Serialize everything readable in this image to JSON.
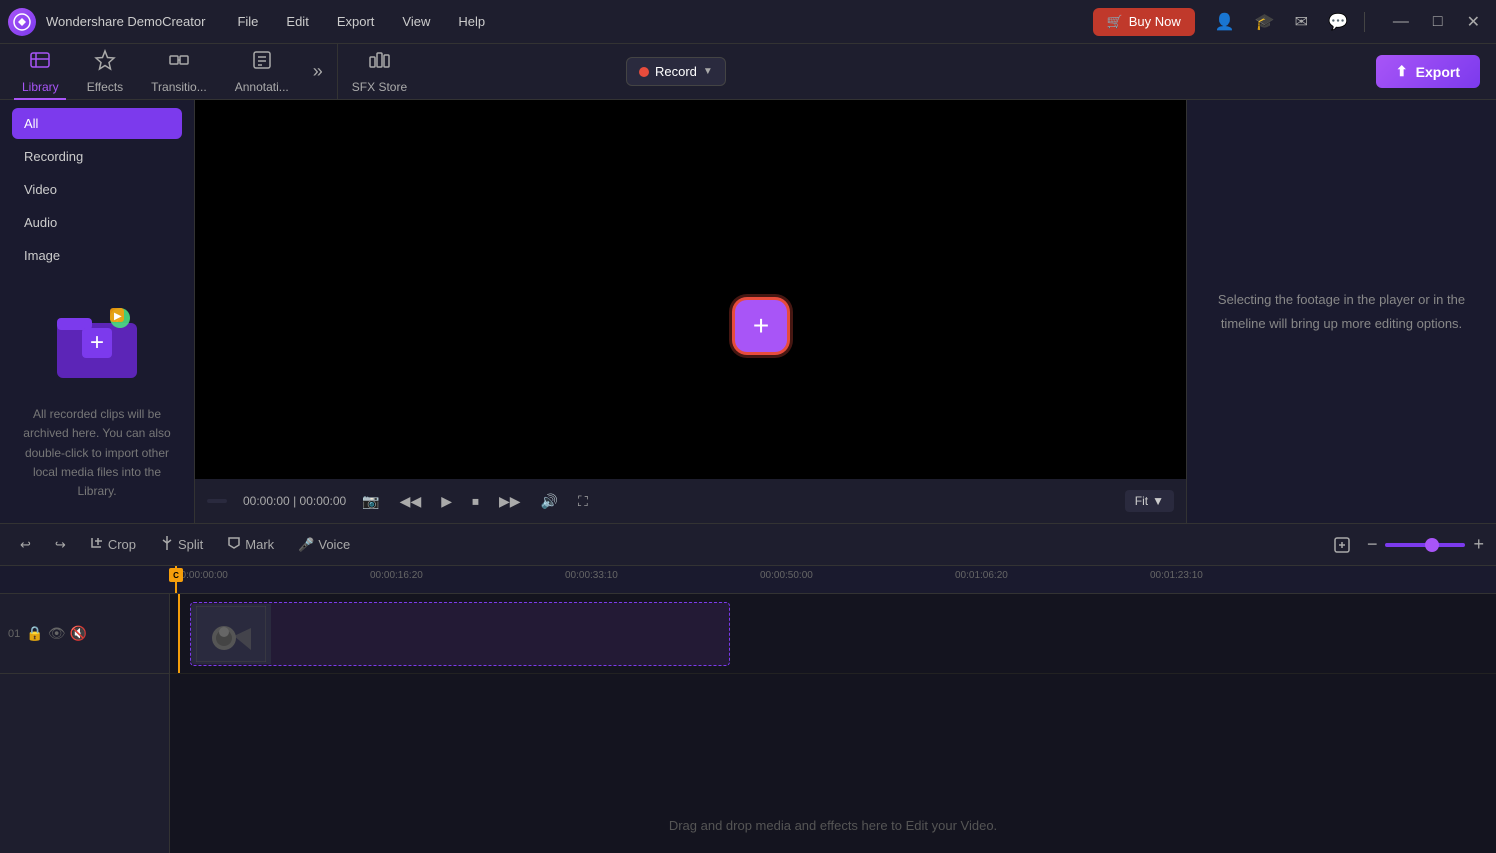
{
  "app": {
    "logo": "W",
    "title": "Wondershare DemoCreator"
  },
  "menubar": {
    "items": [
      "File",
      "Edit",
      "Export",
      "View",
      "Help"
    ],
    "buy_now": "Buy Now",
    "win_min": "—",
    "win_max": "□",
    "win_close": "✕"
  },
  "tabs": {
    "library": "Library",
    "effects": "Effects",
    "transitions": "Transitio...",
    "annotations": "Annotati...",
    "more": "»",
    "sfx_store": "SFX Store"
  },
  "toolbar": {
    "record_label": "Record",
    "export_label": "Export"
  },
  "library": {
    "filter_all": "All",
    "filter_recording": "Recording",
    "filter_video": "Video",
    "filter_audio": "Audio",
    "filter_image": "Image",
    "empty_text": "All recorded clips will be archived here. You can also double-click to import other local media files into the Library."
  },
  "preview": {
    "time_current": "00:00:00",
    "time_total": "00:00:00",
    "fit_label": "Fit"
  },
  "right_info": {
    "message": "Selecting the footage in the player or in the timeline will bring up more editing options."
  },
  "timeline": {
    "crop_label": "Crop",
    "split_label": "Split",
    "mark_label": "Mark",
    "voice_label": "Voice",
    "ruler_marks": [
      "00:00:00:00",
      "00:00:16:20",
      "00:00:33:10",
      "00:00:50:00",
      "00:01:06:20",
      "00:01:23:10"
    ],
    "drop_text": "Drag and drop media and effects here to Edit your Video.",
    "track_num": "01"
  },
  "icons": {
    "library_icon": "📁",
    "effects_icon": "✨",
    "transitions_icon": "⏭",
    "annotations_icon": "📝",
    "sfx_icon": "🎵",
    "undo_icon": "↩",
    "redo_icon": "↪",
    "crop_icon": "⊡",
    "split_icon": "⚡",
    "mark_icon": "⛉",
    "voice_icon": "🎤",
    "record_dot": "●",
    "export_icon": "↑",
    "camera_icon": "📷",
    "prev_icon": "⏮",
    "play_icon": "▶",
    "stop_icon": "⏹",
    "next_icon": "⏭",
    "volume_icon": "🔊",
    "fullscreen_icon": "⛶",
    "lock_icon": "🔒",
    "eye_icon": "👁",
    "audio_icon": "🔇",
    "zoom_in": "+",
    "zoom_out": "−",
    "fit_icon": "⊟"
  }
}
